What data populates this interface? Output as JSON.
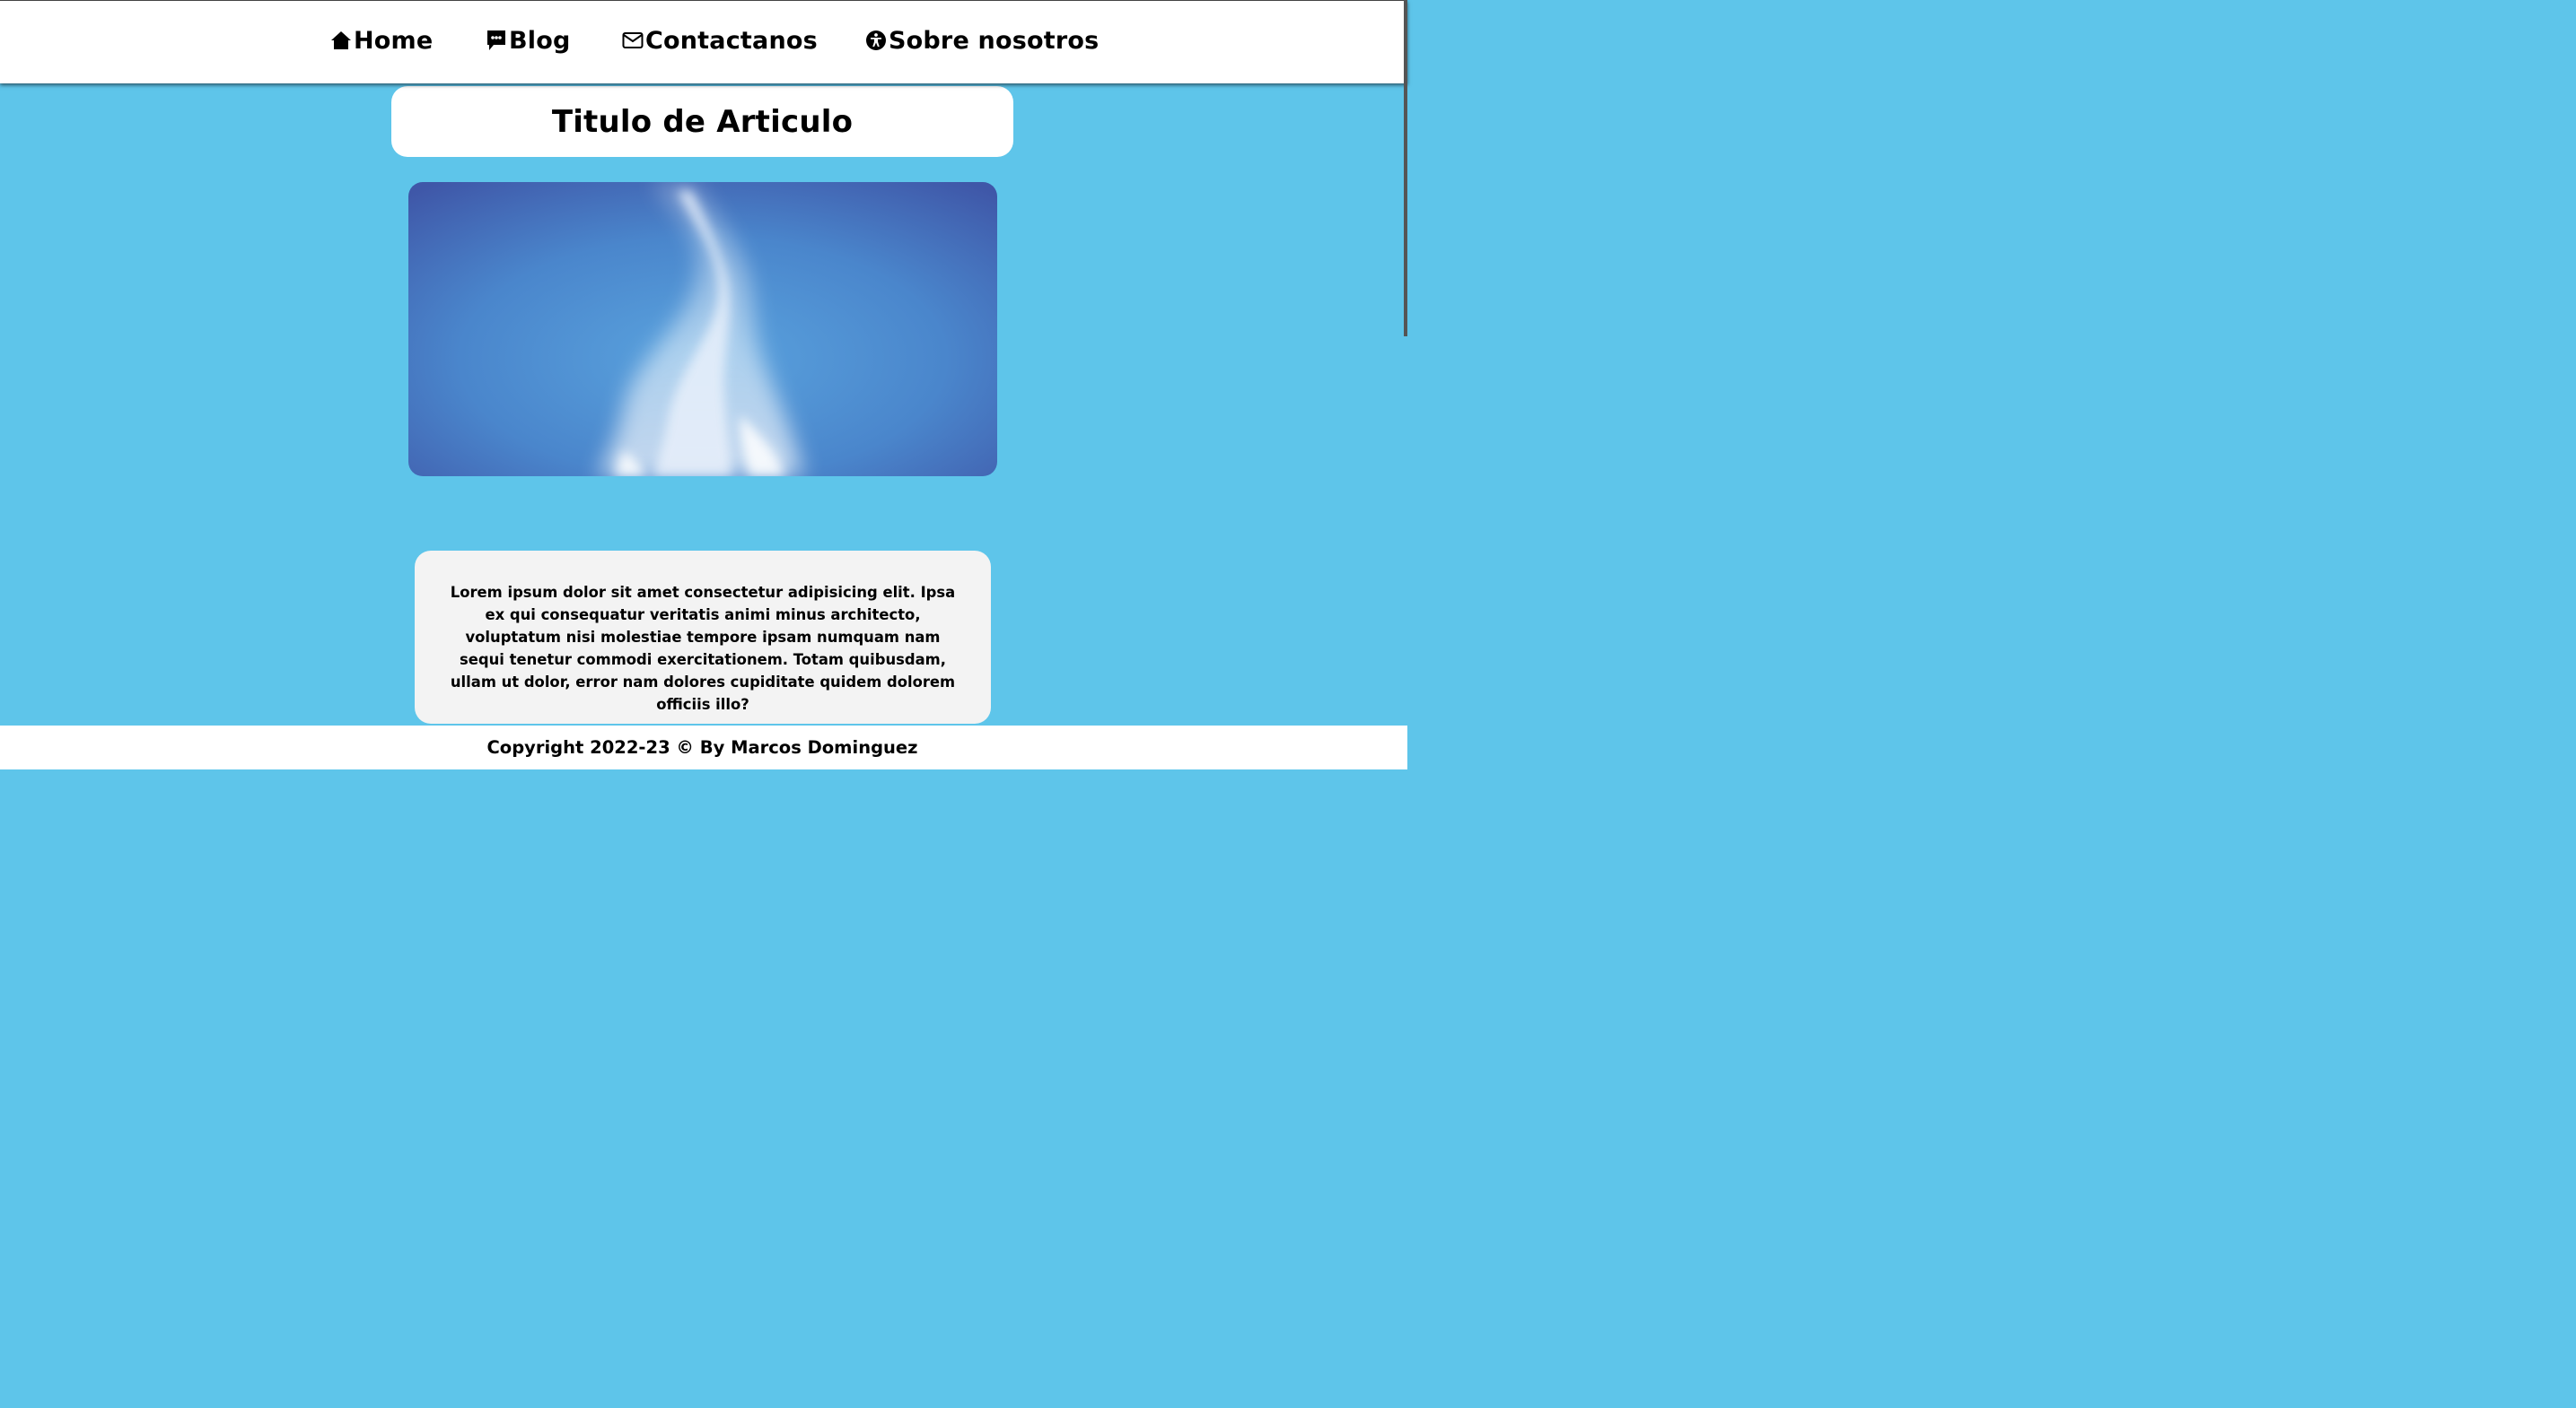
{
  "nav": {
    "items": [
      {
        "label": "Home",
        "icon": "home-icon"
      },
      {
        "label": "Blog",
        "icon": "chat-icon"
      },
      {
        "label": "Contactanos",
        "icon": "mail-icon"
      },
      {
        "label": "Sobre nosotros",
        "icon": "accessibility-icon"
      }
    ]
  },
  "article": {
    "title": "Titulo de Articulo",
    "body": "Lorem ipsum dolor sit amet consectetur adipisicing elit. Ipsa ex qui consequatur veritatis animi minus architecto, voluptatum nisi molestiae tempore ipsam numquam nam sequi tenetur commodi exercitationem. Totam quibusdam, ullam ut dolor, error nam dolores cupiditate quidem dolorem officiis illo?"
  },
  "footer": {
    "copyright": "Copyright 2022-23 © By Marcos Dominguez"
  },
  "colors": {
    "page_background": "#5ec5ea",
    "card_background": "#ffffff",
    "text_card_background": "#f3f3f3",
    "sky_blue": "#4a8fd0"
  }
}
